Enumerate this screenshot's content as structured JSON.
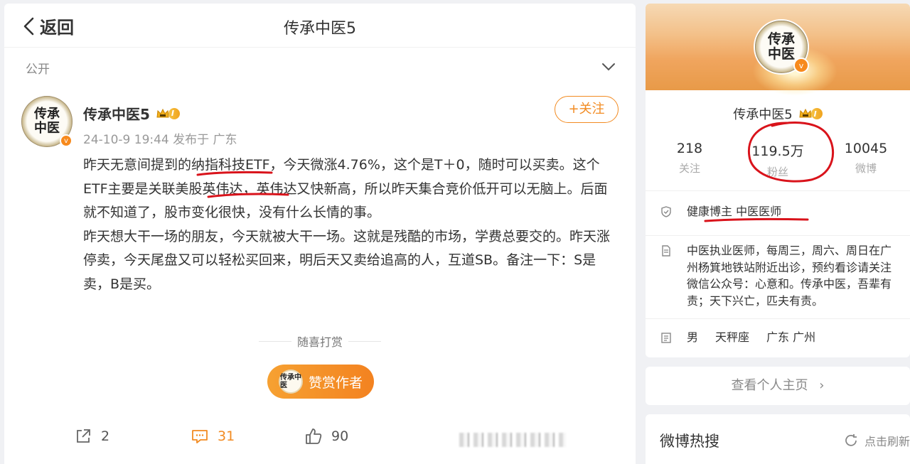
{
  "header": {
    "back_label": "返回",
    "title": "传承中医5"
  },
  "privacy": {
    "label": "公开"
  },
  "post": {
    "author_name": "传承中医5",
    "level_badge": "I",
    "meta": "24-10-9 19:44 发布于 广东",
    "follow_label": "+关注",
    "avatar_text": "传承中医",
    "avatar_text_small": "传承中医",
    "paragraphs": {
      "p1": "昨天无意间提到的纳指科技ETF，今天微涨4.76%，这个是T＋0，随时可以买卖。这个ETF主要是关联美股英伟达，英伟达又快新高，所以昨天集合竞价低开可以无脑上。后面就不知道了，股市变化很快，没有什么长情的事。",
      "p2": "昨天想大干一场的朋友，今天就被大干一场。这就是残酷的市场，学费总要交的。昨天涨停卖，今天尾盘又可以轻松买回来，明后天又卖给追高的人，互道SB。备注一下：S是卖，B是买。"
    },
    "reward_hint": "随喜打赏",
    "reward_button": "赞赏作者",
    "actions": {
      "share_count": "2",
      "comment_count": "31",
      "like_count": "90"
    }
  },
  "profile": {
    "name": "传承中医5",
    "level_badge": "I",
    "avatar_text": "传承中医",
    "stats": [
      {
        "num": "218",
        "label": "关注"
      },
      {
        "num": "119.5万",
        "label": "粉丝"
      },
      {
        "num": "10045",
        "label": "微博"
      }
    ],
    "verified": "健康博主 中医医师",
    "bio": "中医执业医师，每周三，周六、周日在广州杨箕地铁站附近出诊，预约看诊请关注微信公众号：心意和。传承中医，吾辈有责；天下兴亡，匹夫有责。",
    "gender": "男",
    "zodiac": "天秤座",
    "location": "广东 广州",
    "homepage_label": "查看个人主页"
  },
  "hot_search": {
    "title": "微博热搜",
    "refresh_label": "点击刷新"
  },
  "colors": {
    "accent": "#f28b22",
    "annotation_red": "#d9131b"
  }
}
